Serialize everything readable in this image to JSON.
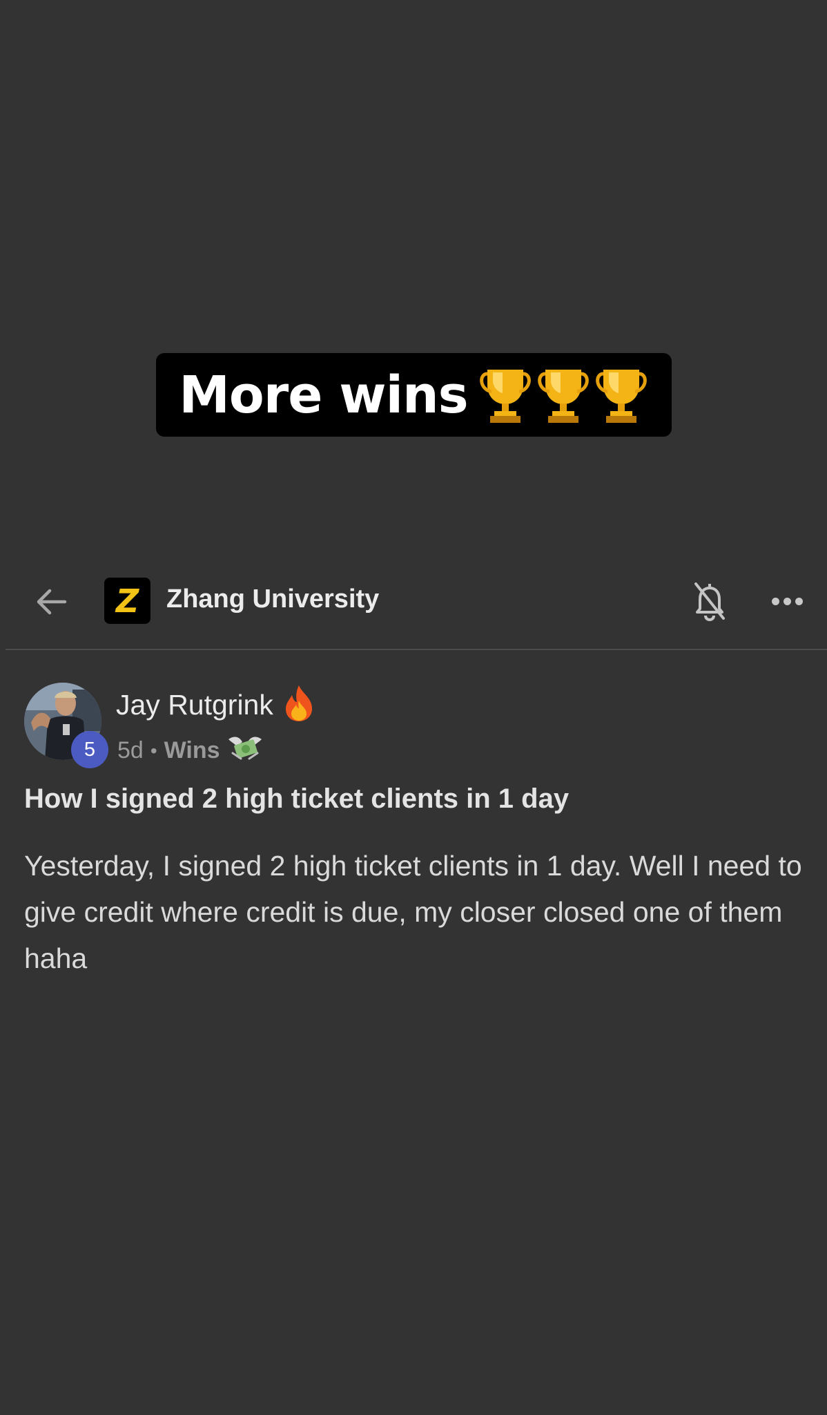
{
  "caption": {
    "text": "More wins",
    "emoji": [
      "trophy-icon",
      "trophy-icon",
      "trophy-icon"
    ]
  },
  "header": {
    "back_icon": "arrow-left-icon",
    "group_logo_letter": "Z",
    "group_name": "Zhang University",
    "bell_icon": "bell-off-icon",
    "more_icon": "more-horizontal-icon"
  },
  "post": {
    "author": "Jay Rutgrink",
    "author_emoji": "fire-icon",
    "level": "5",
    "age": "5d",
    "separator": "•",
    "category": "Wins",
    "category_emoji": "money-with-wings-icon",
    "title": "How I signed 2 high ticket clients in 1 day",
    "body": "Yesterday, I signed 2 high ticket clients in 1 day. Well I need to give credit where credit is due, my closer closed one of them haha"
  },
  "colors": {
    "background": "#333333",
    "caption_bg": "#000000",
    "logo_yellow": "#f2c316",
    "level_badge": "#4c5bc2"
  }
}
